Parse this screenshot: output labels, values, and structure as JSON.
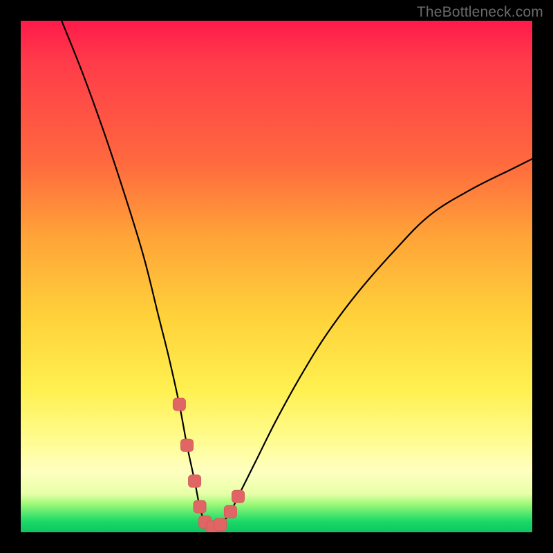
{
  "watermark": "TheBottleneck.com",
  "colors": {
    "frame": "#000000",
    "grad_top": "#ff1a4a",
    "grad_mid": "#ffd23a",
    "grad_bottom": "#0fc661",
    "curve": "#000000",
    "marker": "#e06666"
  },
  "chart_data": {
    "type": "line",
    "title": "",
    "xlabel": "",
    "ylabel": "",
    "xlim": [
      0,
      100
    ],
    "ylim": [
      0,
      100
    ],
    "series": [
      {
        "name": "bottleneck-curve",
        "x": [
          8,
          12,
          16,
          20,
          24,
          27,
          29,
          31,
          32.5,
          34,
          35,
          36,
          37.5,
          39,
          41,
          43,
          46,
          50,
          55,
          60,
          66,
          73,
          80,
          88,
          96,
          100
        ],
        "y": [
          100,
          90,
          79,
          67,
          54,
          42,
          34,
          25,
          17,
          10,
          5,
          2,
          1,
          1.5,
          4,
          8,
          14,
          22,
          31,
          39,
          47,
          55,
          62,
          67,
          71,
          73
        ]
      }
    ],
    "markers": {
      "name": "highlighted-points",
      "x": [
        31,
        32.5,
        34,
        35,
        36,
        37.5,
        39,
        41,
        42.5
      ],
      "y": [
        25,
        17,
        10,
        5,
        2,
        1,
        1.5,
        4,
        7
      ]
    }
  }
}
